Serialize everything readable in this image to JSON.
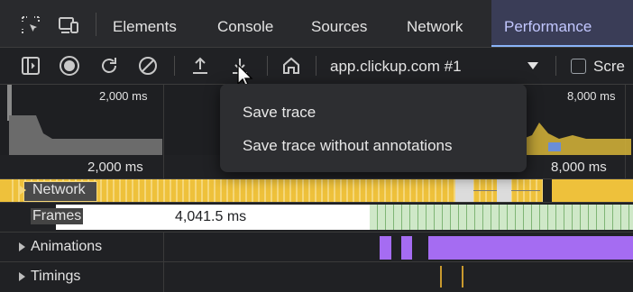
{
  "tabs": {
    "elements": "Elements",
    "console": "Console",
    "sources": "Sources",
    "network": "Network",
    "performance": "Performance"
  },
  "toolbar": {
    "target_select": "app.clickup.com #1",
    "screenshots_partial": "Scre"
  },
  "overview": {
    "tick_left": "2,000 ms",
    "tick_right": "8,000 ms"
  },
  "ruler": {
    "tick_left": "2,000 ms",
    "tick_right": "8,000 ms"
  },
  "tracks": {
    "network": "Network",
    "frames": "Frames",
    "frame_duration": "4,041.5 ms",
    "animations": "Animations",
    "timings": "Timings"
  },
  "menu": {
    "save_trace": "Save trace",
    "save_trace_without_annotations": "Save trace without annotations"
  },
  "colors": {
    "accent_tab": "#c2c7ff",
    "network_track": "#f0c33b",
    "frames_track": "#cfe8c8",
    "animations_track": "#a56cf2"
  }
}
